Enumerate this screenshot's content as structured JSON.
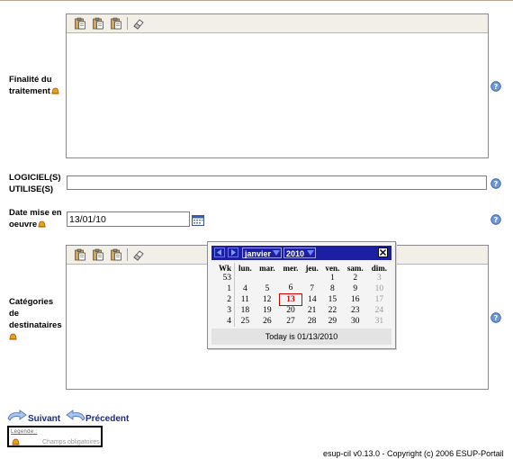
{
  "form": {
    "finalite_label": "Finalité du traitement",
    "logiciels_label": "LOGICIEL(S) UTILISE(S)",
    "logiciels_value": "",
    "date_label": "Date mise en oeuvre",
    "date_value": "13/01/10",
    "categories_label": "Catégories de destinataires"
  },
  "calendar": {
    "month": "janvier",
    "year": "2010",
    "headers": [
      "Wk",
      "lun.",
      "mar.",
      "mer.",
      "jeu.",
      "ven.",
      "sam.",
      "dim."
    ],
    "weeks": [
      {
        "wk": "53",
        "days": [
          "",
          "",
          "",
          "",
          "1",
          "2",
          "3"
        ]
      },
      {
        "wk": "1",
        "days": [
          "4",
          "5",
          "6",
          "7",
          "8",
          "9",
          "10"
        ]
      },
      {
        "wk": "2",
        "days": [
          "11",
          "12",
          "13",
          "14",
          "15",
          "16",
          "17"
        ]
      },
      {
        "wk": "3",
        "days": [
          "18",
          "19",
          "20",
          "21",
          "22",
          "23",
          "24"
        ]
      },
      {
        "wk": "4",
        "days": [
          "25",
          "26",
          "27",
          "28",
          "29",
          "30",
          "31"
        ]
      }
    ],
    "selected_day": "13",
    "footer": "Today is 01/13/2010"
  },
  "nav": {
    "next_label": "Suivant",
    "prev_label": "Précedent"
  },
  "legend": {
    "title": "Legende :",
    "required_text": "Champs obligatoires"
  },
  "footer": "esup-cil v0.13.0 - Copyright (c) 2006 ESUP-Portail",
  "icons": {
    "required": "required-field-icon",
    "help": "help-icon",
    "calendar": "calendar-icon"
  },
  "colors": {
    "calendar_header": "#1d1fa3",
    "today_highlight": "#d40000",
    "nav_link": "#1c2c80"
  }
}
